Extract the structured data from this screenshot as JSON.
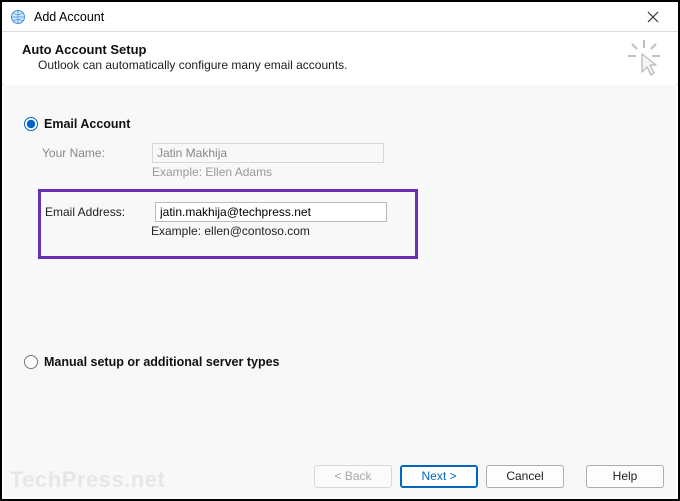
{
  "titlebar": {
    "title": "Add Account"
  },
  "header": {
    "heading": "Auto Account Setup",
    "subheading": "Outlook can automatically configure many email accounts."
  },
  "account_type": {
    "email_label": "Email Account",
    "manual_label": "Manual setup or additional server types",
    "selected": "email"
  },
  "form": {
    "name": {
      "label": "Your Name:",
      "value": "Jatin Makhija",
      "example": "Example: Ellen Adams"
    },
    "email": {
      "label": "Email Address:",
      "value": "jatin.makhija@techpress.net",
      "example": "Example: ellen@contoso.com"
    }
  },
  "footer": {
    "back": "< Back",
    "next": "Next >",
    "cancel": "Cancel",
    "help": "Help"
  },
  "watermark": "TechPress.net"
}
